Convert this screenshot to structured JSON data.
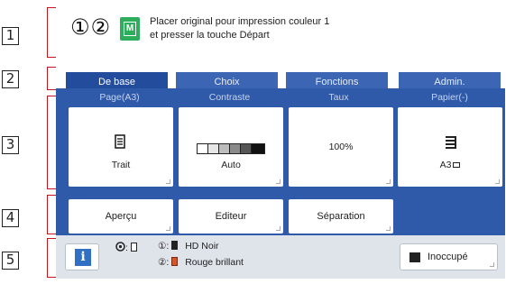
{
  "callouts": [
    "1",
    "2",
    "3",
    "4",
    "5"
  ],
  "message": {
    "job_markers": "①②",
    "mode_icon": "mono-print-icon",
    "mode_letter": "M",
    "line1": "Placer original pour impression couleur 1",
    "line2": "et presser la touche Départ"
  },
  "tabs": [
    {
      "label": "De base",
      "active": true
    },
    {
      "label": "Choix",
      "active": false
    },
    {
      "label": "Fonctions",
      "active": false
    },
    {
      "label": "Admin.",
      "active": false
    }
  ],
  "settings": [
    {
      "label": "Page(A3)",
      "value": "Trait",
      "icon": "document-icon"
    },
    {
      "label": "Contraste",
      "value": "Auto",
      "icon": "contrast-scale-icon"
    },
    {
      "label": "Taux",
      "value": "100%",
      "icon": ""
    },
    {
      "label": "Papier(-)",
      "value": "A3",
      "icon": "paper-stack-icon"
    }
  ],
  "secondary_buttons": [
    "Aperçu",
    "Editeur",
    "Séparation"
  ],
  "status": {
    "drum_label": ":",
    "row1_marker": "①:",
    "row1_value": "HD Noir",
    "row2_marker": "②:",
    "row2_value": "Rouge brillant",
    "row1_color": "#222222",
    "row2_color": "#d9532b",
    "busy_label": "Inoccupé"
  },
  "colors": {
    "panel_blue": "#2f5aa9",
    "tab_active": "#234c9c",
    "mode_green": "#2eae5c",
    "callout_bracket": "#c0171e"
  }
}
